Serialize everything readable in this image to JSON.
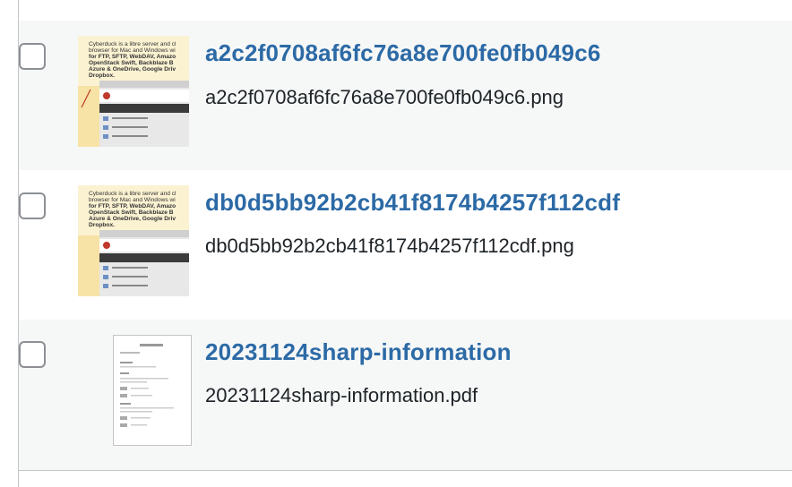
{
  "rows": [
    {
      "title": "a2c2f0708af6fc76a8e700fe0fb049c6",
      "filename": "a2c2f0708af6fc76a8e700fe0fb049c6.png",
      "thumb_type": "image",
      "thumb_lines": [
        "Cyberduck is a libre server and cl",
        "browser for Mac and Windows wi",
        "for FTP, SFTP, WebDAV, Amazo",
        "OpenStack Swift, Backblaze B",
        "Azure & OneDrive, Google Driv",
        "Dropbox."
      ]
    },
    {
      "title": "db0d5bb92b2cb41f8174b4257f112cdf",
      "filename": "db0d5bb92b2cb41f8174b4257f112cdf.png",
      "thumb_type": "image",
      "thumb_lines": [
        "Cyberduck is a libre server and cl",
        "browser for Mac and Windows wi",
        "for FTP, SFTP, WebDAV, Amazo",
        "OpenStack Swift, Backblaze B",
        "Azure & OneDrive, Google Driv",
        "Dropbox."
      ]
    },
    {
      "title": "20231124sharp-information",
      "filename": "20231124sharp-information.pdf",
      "thumb_type": "pdf"
    }
  ],
  "colors": {
    "link": "#2c6aa6",
    "text": "#1d2327",
    "alt_row": "#f6f7f7",
    "border": "#c3c4c7"
  }
}
